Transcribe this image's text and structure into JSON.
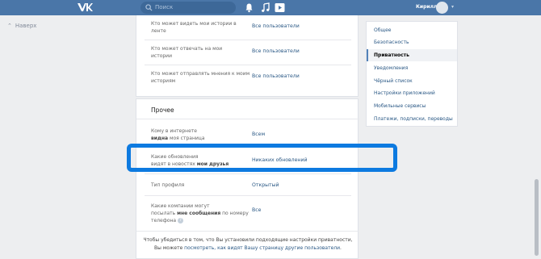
{
  "header": {
    "search_placeholder": "Поиск",
    "user_name": "Кирилл",
    "caret": "▾"
  },
  "back_link": {
    "label": "Наверх"
  },
  "stories_rows": [
    {
      "label": "Кто может видеть мои истории в ленте",
      "value": "Все пользователи"
    },
    {
      "label": "Кто может отвечать на мои истории",
      "value": "Все пользователи"
    },
    {
      "label": "Кто может отправлять мнения к моим историям",
      "value": "Все пользователи"
    }
  ],
  "other": {
    "title": "Прочее",
    "rows": [
      {
        "label_1": "Кому в интернете",
        "label_2_bold": "видна",
        "label_2_rest": " моя страница",
        "value": "Всем"
      },
      {
        "label_1": "Какие обновления",
        "label_2_rest": "видят в новостях ",
        "label_2_bold": "мои друзья",
        "value": "Никаких обновлений"
      },
      {
        "label": "Тип профиля",
        "value": "Открытый"
      },
      {
        "label_1": "Какие компании могут",
        "label_2_rest": "посылать ",
        "label_2_bold": "мне сообщения",
        "label_2_tail": " по номеру",
        "label_3": "телефона",
        "qmark": "?",
        "value": "Все"
      }
    ]
  },
  "footer_note": {
    "line1": "Чтобы убедиться в том, что Вы установили подходящие настройки приватности,",
    "line2_pre": "Вы можете ",
    "link": "посмотреть, как видят Вашу страницу другие пользователи",
    "line2_post": "."
  },
  "settings_menu": [
    {
      "label": "Общее",
      "active": false
    },
    {
      "label": "Безопасность",
      "active": false
    },
    {
      "label": "Приватность",
      "active": true
    },
    {
      "label": "Уведомления",
      "active": false
    },
    {
      "label": "Чёрный список",
      "active": false
    },
    {
      "label": "Настройки приложений",
      "active": false
    },
    {
      "label": "Мобильные сервисы",
      "active": false
    },
    {
      "label": "Платежи, подписки, переводы",
      "active": false
    }
  ],
  "colors": {
    "header_bg": "#4a76a8",
    "link": "#2a5885",
    "highlight": "#0d7ae0"
  }
}
